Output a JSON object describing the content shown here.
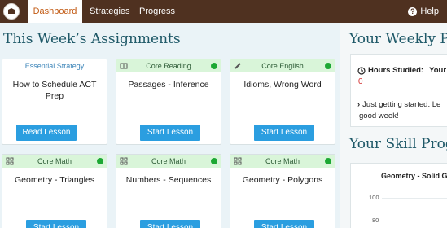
{
  "nav": {
    "tabs": [
      {
        "label": "Dashboard",
        "active": true
      },
      {
        "label": "Strategies",
        "active": false
      },
      {
        "label": "Progress",
        "active": false
      }
    ],
    "help_label": "Help"
  },
  "assignments": {
    "title": "This Week’s Assignments",
    "cards": [
      {
        "category": "Essential Strategy",
        "title": "How to Schedule ACT Prep",
        "button": "Read Lesson",
        "icon": "none"
      },
      {
        "category": "Core Reading",
        "title": "Passages - Inference",
        "button": "Start Lesson",
        "icon": "book-icon"
      },
      {
        "category": "Core English",
        "title": "Idioms, Wrong Word",
        "button": "Start Lesson",
        "icon": "pencil-icon"
      },
      {
        "category": "Core Math",
        "title": "Geometry - Triangles",
        "button": "Start Lesson",
        "icon": "grid-icon"
      },
      {
        "category": "Core Math",
        "title": "Numbers - Sequences",
        "button": "Start Lesson",
        "icon": "grid-icon"
      },
      {
        "category": "Core Math",
        "title": "Geometry - Polygons",
        "button": "Start Lesson",
        "icon": "grid-icon"
      }
    ],
    "status_color": "#1da834"
  },
  "weekly": {
    "title": "Your Weekly P",
    "hours_label": "Hours Studied:",
    "hours_label2": "Your",
    "hours_value": "0",
    "message_line1": "Just getting started. Le",
    "message_line2": "good week!"
  },
  "skill": {
    "title": "Your Skill Prog",
    "chart_title": "Geometry - Solid G",
    "ticks": [
      "100",
      "80"
    ]
  },
  "colors": {
    "nav_bg": "#4f3120",
    "active_tab_text": "#c25a13",
    "heading": "#1f5968",
    "button": "#2b9ee0"
  }
}
